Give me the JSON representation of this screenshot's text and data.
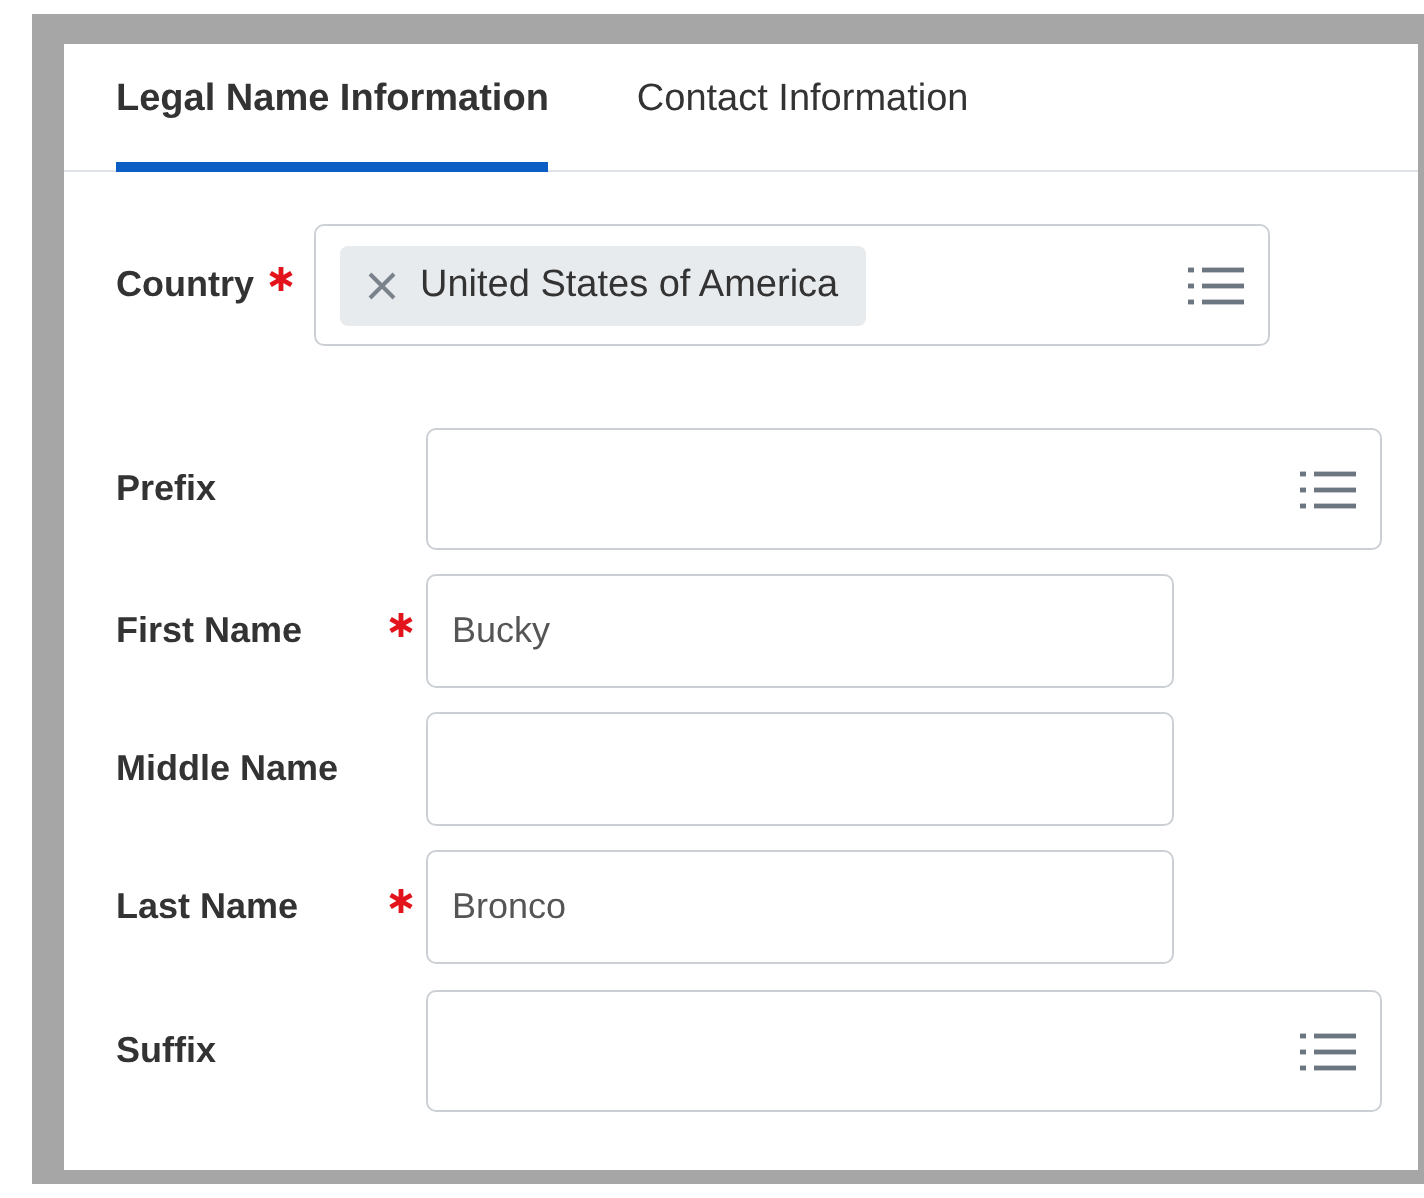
{
  "tabs": [
    {
      "label": "Legal Name Information",
      "selected": true
    },
    {
      "label": "Contact Information",
      "selected": false
    }
  ],
  "fields": [
    {
      "kind": "multiselect",
      "label": "Country",
      "required": true,
      "chips": [
        "United States of America"
      ]
    },
    {
      "kind": "select",
      "label": "Prefix",
      "required": false
    },
    {
      "kind": "text",
      "label": "First Name",
      "required": true,
      "value": "Bucky"
    },
    {
      "kind": "text",
      "label": "Middle Name",
      "required": false
    },
    {
      "kind": "text",
      "label": "Last Name",
      "required": true,
      "value": "Bronco"
    },
    {
      "kind": "select",
      "label": "Suffix",
      "required": false
    }
  ]
}
